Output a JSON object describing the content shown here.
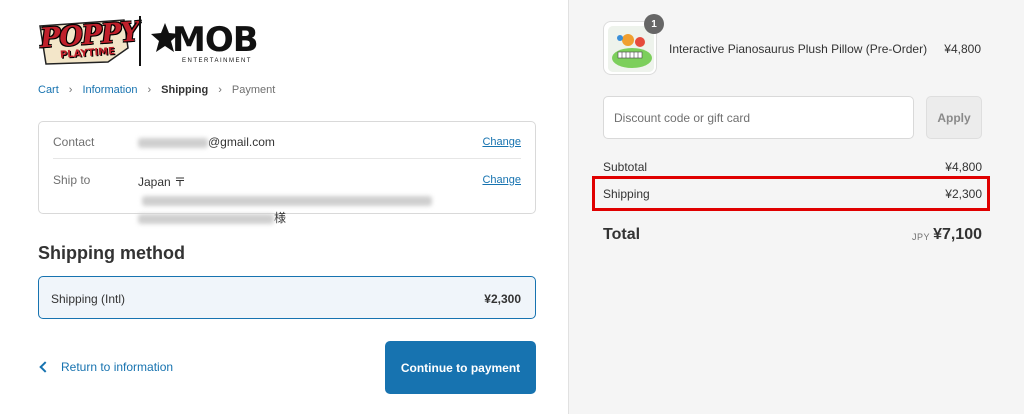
{
  "brand": {
    "logo_left_text": "POPPY PLAYTIME",
    "logo_right_text": "MOB",
    "logo_right_sub": "ENTERTAINMENT"
  },
  "breadcrumb": {
    "cart": "Cart",
    "information": "Information",
    "shipping": "Shipping",
    "payment": "Payment"
  },
  "review": {
    "contact_label": "Contact",
    "contact_value": "@gmail.com",
    "contact_change": "Change",
    "ship_label": "Ship to",
    "ship_value_prefix": "Japan 〒",
    "ship_value_suffix": "様",
    "ship_change": "Change"
  },
  "shipping_method": {
    "title": "Shipping method",
    "name": "Shipping (Intl)",
    "price": "¥2,300"
  },
  "actions": {
    "return_label": "Return to information",
    "continue_label": "Continue to payment"
  },
  "order": {
    "quantity": "1",
    "product_name": "Interactive Pianosaurus Plush Pillow (Pre-Order)",
    "product_price": "¥4,800"
  },
  "discount": {
    "placeholder": "Discount code or gift card",
    "apply_label": "Apply"
  },
  "summary": {
    "subtotal_label": "Subtotal",
    "subtotal_value": "¥4,800",
    "shipping_label": "Shipping",
    "shipping_value": "¥2,300",
    "total_label": "Total",
    "currency": "JPY",
    "total_value": "¥7,100"
  },
  "colors": {
    "accent": "#1773b0",
    "highlight": "#e00000"
  }
}
